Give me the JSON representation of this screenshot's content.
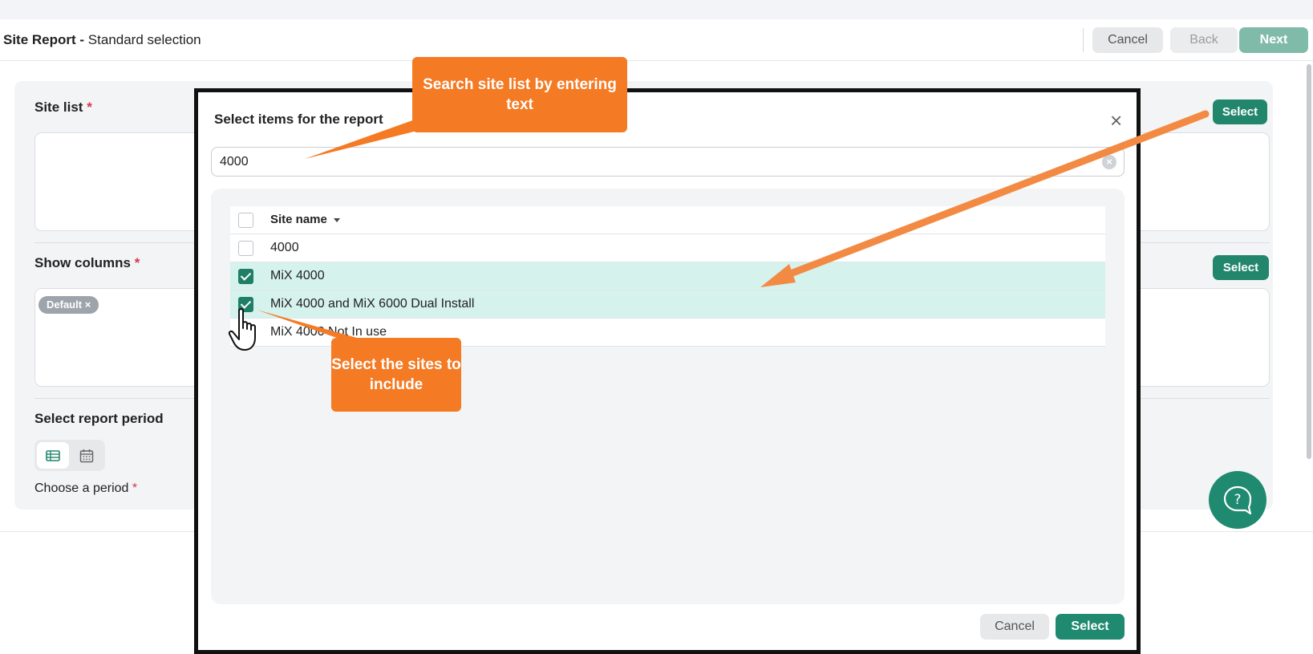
{
  "header": {
    "title_bold": "Site Report - ",
    "title_rest": "Standard selection",
    "cancel_label": "Cancel",
    "back_label": "Back",
    "next_label": "Next"
  },
  "form": {
    "site_list_label": "Site list",
    "site_list_select": "Select",
    "show_columns_label": "Show columns",
    "show_columns_select": "Select",
    "default_chip": "Default",
    "chip_remove": "×",
    "report_period_label": "Select report period",
    "choose_period_label": "Choose a period",
    "required_mark": "*"
  },
  "modal": {
    "title": "Select items for the report",
    "close": "×",
    "search_value": "4000",
    "clear": "×",
    "column_header": "Site name",
    "rows": [
      {
        "name": "4000",
        "checked": false
      },
      {
        "name": "MiX 4000",
        "checked": true
      },
      {
        "name": "MiX 4000 and MiX 6000 Dual Install",
        "checked": true
      },
      {
        "name": "MiX 4000 Not In use",
        "checked": false
      }
    ],
    "cancel_label": "Cancel",
    "select_label": "Select"
  },
  "callouts": {
    "search_hint": "Search site list by entering text",
    "select_hint": "Select the sites to include"
  },
  "colors": {
    "brand_green": "#1f8a6f",
    "callout_orange": "#f47a24",
    "selected_row": "#d6f2ed"
  }
}
